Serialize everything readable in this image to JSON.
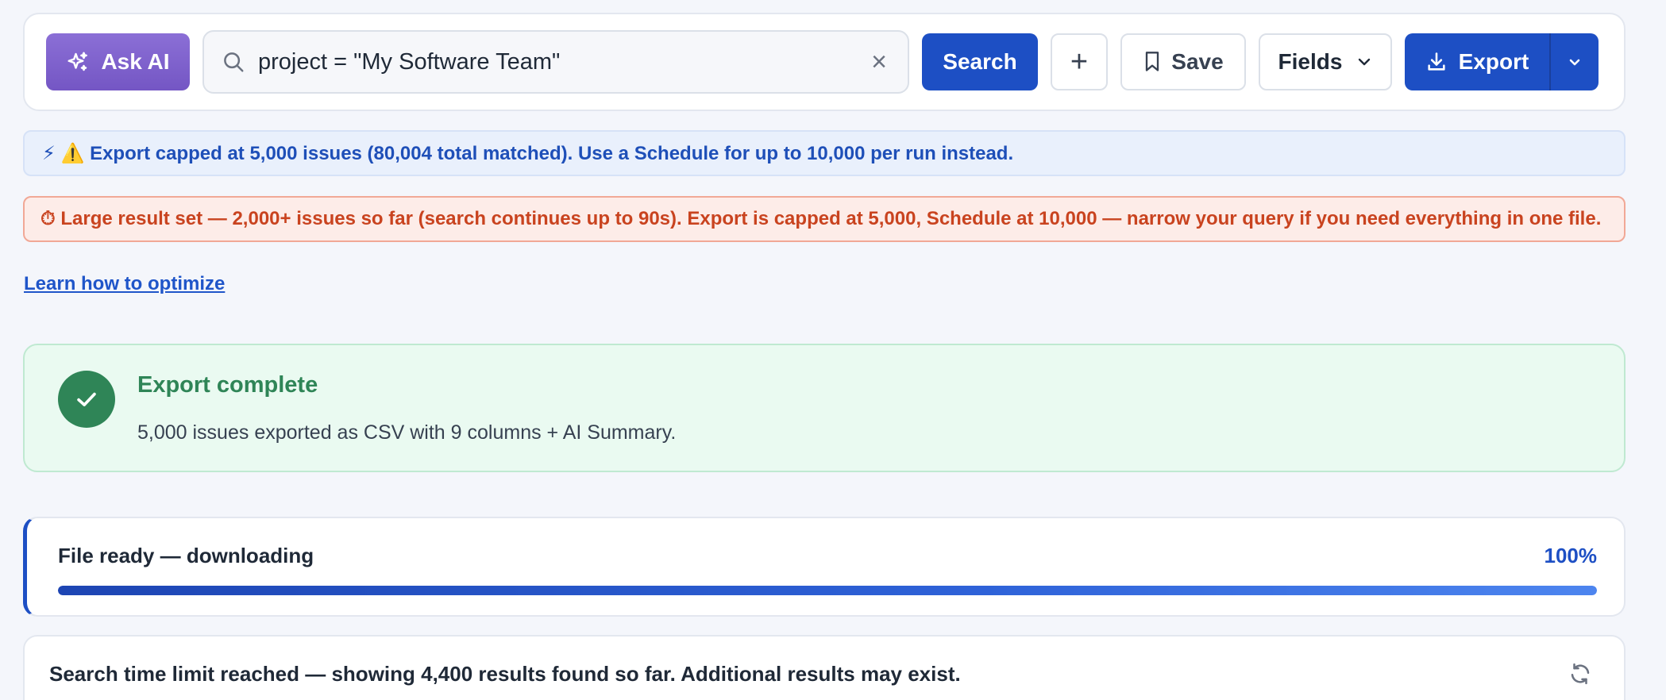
{
  "toolbar": {
    "ask_ai_label": "Ask AI",
    "search_value": "project = \"My Software Team\"",
    "clear_symbol": "×",
    "search_button_label": "Search",
    "add_symbol": "+",
    "save_label": "Save",
    "fields_label": "Fields",
    "export_label": "Export"
  },
  "banners": {
    "info_text": "⚡ ⚠️ Export capped at 5,000 issues (80,004 total matched). Use a Schedule for up to 10,000 per run instead.",
    "error_text": "⏱ Large result set — 2,000+ issues so far (search continues up to 90s). Export is capped at 5,000, Schedule at 10,000 — narrow your query if you need everything in one file.",
    "optimize_link": "Learn how to optimize"
  },
  "success": {
    "title": "Export complete",
    "description": "5,000 issues exported as CSV with 9 columns + AI Summary."
  },
  "progress": {
    "label": "File ready — downloading",
    "percent_text": "100%",
    "fraction": 1.0
  },
  "limit": {
    "text": "Search time limit reached — showing 4,400 results found so far. Additional results may exist."
  },
  "colors": {
    "primary": "#1d4fc4",
    "ai_purple": "#7c5fcf",
    "success": "#2f8557",
    "error": "#c9431f",
    "info": "#1e4fb8"
  },
  "icons": [
    "sparkles-icon",
    "search-icon",
    "close-icon",
    "plus-icon",
    "bookmark-icon",
    "chevron-down-icon",
    "download-icon",
    "check-icon",
    "refresh-icon"
  ]
}
